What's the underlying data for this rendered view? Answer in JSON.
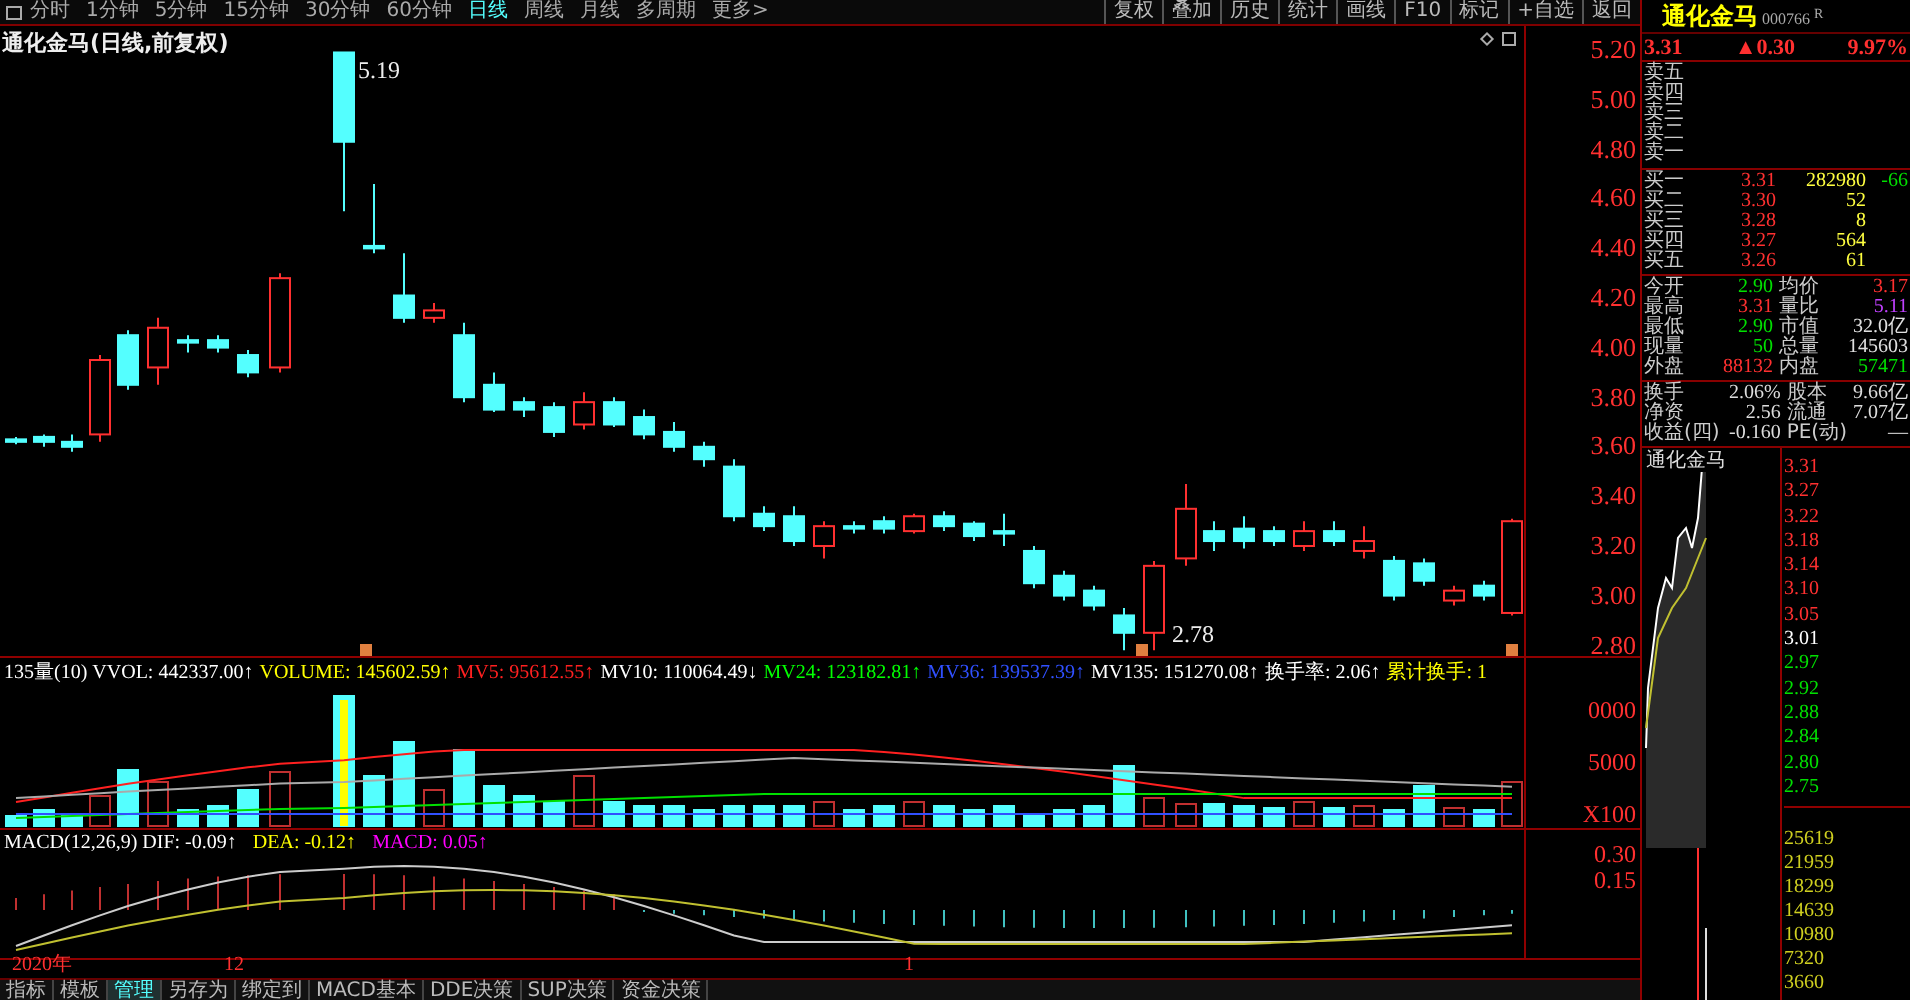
{
  "toolbar": {
    "periods": [
      {
        "label": "分时",
        "selected": false
      },
      {
        "label": "1分钟",
        "selected": false
      },
      {
        "label": "5分钟",
        "selected": false
      },
      {
        "label": "15分钟",
        "selected": false
      },
      {
        "label": "30分钟",
        "selected": false
      },
      {
        "label": "60分钟",
        "selected": false
      },
      {
        "label": "日线",
        "selected": true
      },
      {
        "label": "周线",
        "selected": false
      },
      {
        "label": "月线",
        "selected": false
      },
      {
        "label": "多周期",
        "selected": false
      },
      {
        "label": "更多>",
        "selected": false
      }
    ],
    "tools": [
      "复权",
      "叠加",
      "历史",
      "统计",
      "画线",
      "F10",
      "标记",
      "+自选",
      "返回"
    ]
  },
  "chart": {
    "title": "通化金马(日线,前复权)",
    "high_label": "5.19",
    "low_label": "2.78",
    "price_ticks": [
      "5.20",
      "5.00",
      "4.80",
      "4.60",
      "4.40",
      "4.20",
      "4.00",
      "3.80",
      "3.60",
      "3.40",
      "3.20",
      "3.00",
      "2.80"
    ]
  },
  "volume": {
    "legend": [
      {
        "text": "135量(10) VVOL: 442337.00↑",
        "color": "#ffffff"
      },
      {
        "text": "VOLUME: 145602.59↑",
        "color": "#ffff00"
      },
      {
        "text": "MV5: 95612.55↑",
        "color": "#ff2020"
      },
      {
        "text": "MV10: 110064.49↓",
        "color": "#ffffff"
      },
      {
        "text": "MV24: 123182.81↑",
        "color": "#00ff00"
      },
      {
        "text": "MV36: 139537.39↑",
        "color": "#3050ff"
      },
      {
        "text": "MV135: 151270.08↑",
        "color": "#ffffff"
      },
      {
        "text": "换手率: 2.06↑",
        "color": "#ffffff"
      },
      {
        "text": "累计换手: 1",
        "color": "#ffff00"
      }
    ],
    "ticks": [
      "0000",
      "5000",
      "X100"
    ]
  },
  "macd": {
    "legend": [
      {
        "text": "MACD(12,26,9) DIF: -0.09↑",
        "color": "#ffffff"
      },
      {
        "text": "DEA: -0.12↑",
        "color": "#ffff00"
      },
      {
        "text": "MACD: 0.05↑",
        "color": "#ff00ff"
      }
    ],
    "ticks": [
      "0.30",
      "0.15"
    ],
    "dates": [
      "2020年",
      "12",
      "1"
    ]
  },
  "bottom_tabs": [
    {
      "label": "指标",
      "selected": false
    },
    {
      "label": "模板",
      "selected": false
    },
    {
      "label": "管理",
      "selected": true
    },
    {
      "label": "另存为",
      "selected": false
    },
    {
      "label": "绑定到",
      "selected": false
    },
    {
      "label": "MACD基本",
      "selected": false
    },
    {
      "label": "DDE决策",
      "selected": false
    },
    {
      "label": "SUP决策",
      "selected": false
    },
    {
      "label": "资金决策",
      "selected": false
    }
  ],
  "quote": {
    "name": "通化金马",
    "code": "000766",
    "flag": "R",
    "price": "3.31",
    "change": "▲0.30",
    "percent": "9.97%",
    "asks": [
      {
        "label": "卖五"
      },
      {
        "label": "卖四"
      },
      {
        "label": "卖三"
      },
      {
        "label": "卖二"
      },
      {
        "label": "卖一"
      }
    ],
    "bids": [
      {
        "label": "买一",
        "price": "3.31",
        "volume": "282980",
        "delta": "-66"
      },
      {
        "label": "买二",
        "price": "3.30",
        "volume": "52"
      },
      {
        "label": "买三",
        "price": "3.28",
        "volume": "8"
      },
      {
        "label": "买四",
        "price": "3.27",
        "volume": "564"
      },
      {
        "label": "买五",
        "price": "3.26",
        "volume": "61"
      }
    ],
    "stats": [
      [
        {
          "label": "今开",
          "value": "2.90",
          "color": "#00e000"
        },
        {
          "label": "均价",
          "value": "3.17",
          "color": "#ff3030"
        }
      ],
      [
        {
          "label": "最高",
          "value": "3.31",
          "color": "#ff3030"
        },
        {
          "label": "量比",
          "value": "5.11",
          "color": "#c040ff"
        }
      ],
      [
        {
          "label": "最低",
          "value": "2.90",
          "color": "#00e000"
        },
        {
          "label": "市值",
          "value": "32.0亿",
          "color": "#e0e0e0"
        }
      ],
      [
        {
          "label": "现量",
          "value": "50",
          "color": "#00e000"
        },
        {
          "label": "总量",
          "value": "145603",
          "color": "#e0e0e0"
        }
      ],
      [
        {
          "label": "外盘",
          "value": "88132",
          "color": "#ff3030"
        },
        {
          "label": "内盘",
          "value": "57471",
          "color": "#00e000"
        }
      ]
    ],
    "finance": [
      [
        {
          "label": "换手",
          "value": "2.06%"
        },
        {
          "label": "股本",
          "value": "9.66亿"
        }
      ],
      [
        {
          "label": "净资",
          "value": "2.56"
        },
        {
          "label": "流通",
          "value": "7.07亿"
        }
      ],
      [
        {
          "label": "收益(四)",
          "value": "-0.160"
        },
        {
          "label": "PE(动)",
          "value": "—"
        }
      ]
    ]
  },
  "intraday": {
    "title": "通化金马",
    "price_ticks": [
      {
        "label": "3.31",
        "color": "#ff3030"
      },
      {
        "label": "3.27",
        "color": "#ff3030"
      },
      {
        "label": "3.22",
        "color": "#ff3030"
      },
      {
        "label": "3.18",
        "color": "#ff3030"
      },
      {
        "label": "3.14",
        "color": "#ff3030"
      },
      {
        "label": "3.10",
        "color": "#ff3030"
      },
      {
        "label": "3.05",
        "color": "#ff3030"
      },
      {
        "label": "3.01",
        "color": "#ffffff"
      },
      {
        "label": "2.97",
        "color": "#00e000"
      },
      {
        "label": "2.92",
        "color": "#00e000"
      },
      {
        "label": "2.88",
        "color": "#00e000"
      },
      {
        "label": "2.84",
        "color": "#00e000"
      },
      {
        "label": "2.80",
        "color": "#00e000"
      },
      {
        "label": "2.75",
        "color": "#00e000"
      }
    ],
    "volume_ticks": [
      "25619",
      "21959",
      "18299",
      "14639",
      "10980",
      "7320",
      "3660"
    ]
  }
}
